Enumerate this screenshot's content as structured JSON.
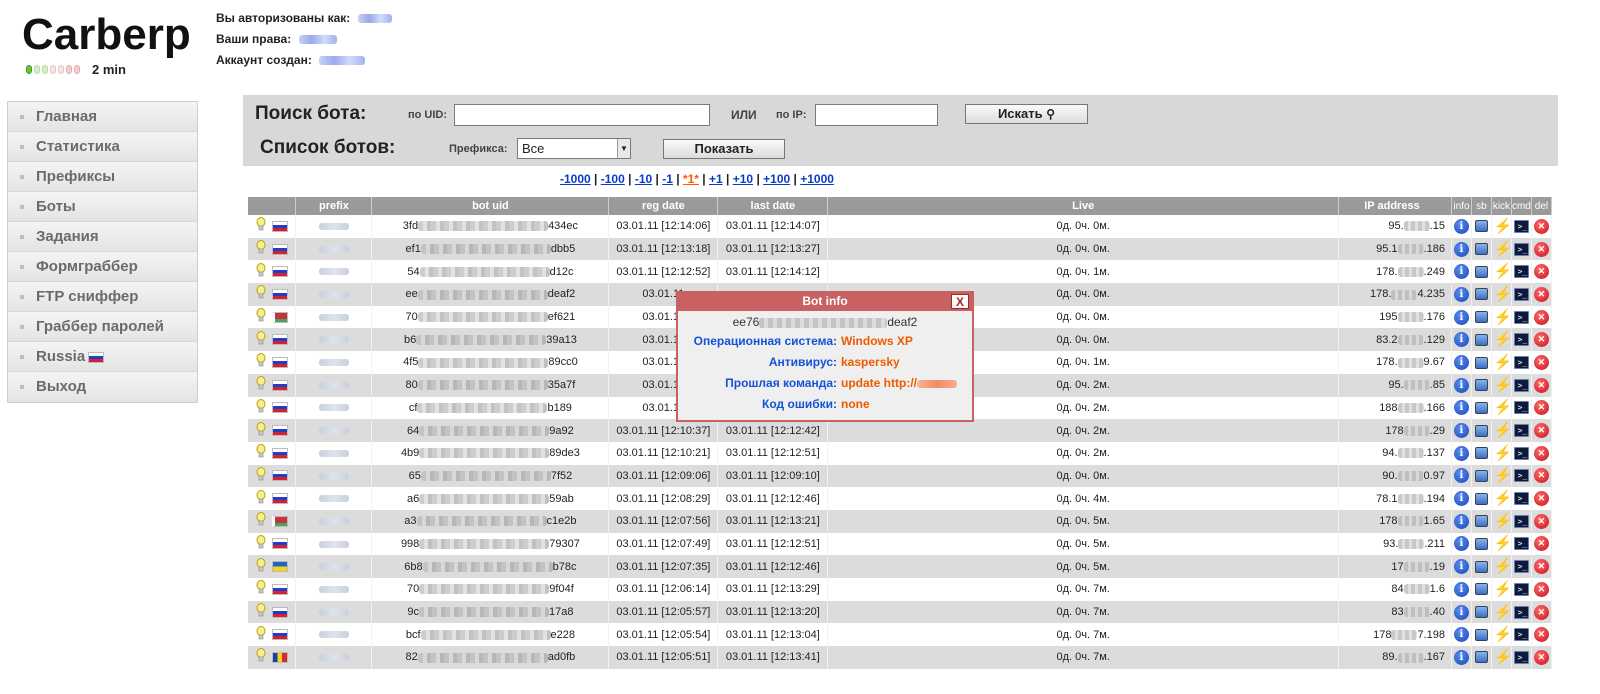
{
  "header": {
    "logo": "Carberp",
    "uptime": "2 min",
    "authorized_as_label": "Вы авторизованы как:",
    "rights_label": "Ваши права:",
    "account_created_label": "Аккаунт создан:"
  },
  "sidebar": {
    "items": [
      {
        "label": "Главная"
      },
      {
        "label": "Статистика"
      },
      {
        "label": "Префиксы"
      },
      {
        "label": "Боты"
      },
      {
        "label": "Задания"
      },
      {
        "label": "Формграббер"
      },
      {
        "label": "FTP сниффер"
      },
      {
        "label": "Граббер паролей"
      },
      {
        "label": "Russia"
      },
      {
        "label": "Выход"
      }
    ]
  },
  "search": {
    "title": "Поиск бота:",
    "uid_label": "по UID:",
    "or_label": "ИЛИ",
    "ip_label": "по IP:",
    "uid_value": "",
    "ip_value": "",
    "search_button": "Искать",
    "list_title": "Список ботов:",
    "prefix_label": "Префикса:",
    "prefix_selected": "Все",
    "show_button": "Показать"
  },
  "pager": {
    "links": [
      "-1000",
      "-100",
      "-10",
      "-1",
      "*1*",
      "+1",
      "+10",
      "+100",
      "+1000"
    ],
    "separator": "|"
  },
  "table": {
    "headers": {
      "prefix": "prefix",
      "uid": "bot uid",
      "reg": "reg date",
      "last": "last date",
      "live": "Live",
      "ip": "IP address",
      "info": "info",
      "sb": "sb",
      "kick": "kick",
      "cmd": "cmd",
      "del": "del"
    },
    "rows": [
      {
        "flag": "ru",
        "uid_start": "3fd",
        "uid_end": "434ec",
        "reg": "03.01.11 [12:14:06]",
        "last": "03.01.11 [12:14:07]",
        "live": "0д. 0ч. 0м.",
        "ip_start": "95.",
        "ip_end": ".15"
      },
      {
        "flag": "ru",
        "uid_start": "ef1",
        "uid_end": "dbb5",
        "reg": "03.01.11 [12:13:18]",
        "last": "03.01.11 [12:13:27]",
        "live": "0д. 0ч. 0м.",
        "ip_start": "95.1",
        "ip_end": ".186"
      },
      {
        "flag": "ru",
        "uid_start": "54",
        "uid_end": "d12c",
        "reg": "03.01.11 [12:12:52]",
        "last": "03.01.11 [12:14:12]",
        "live": "0д. 0ч. 1м.",
        "ip_start": "178.",
        "ip_end": ".249"
      },
      {
        "flag": "ru",
        "uid_start": "ee",
        "uid_end": "deaf2",
        "reg": "03.01.11",
        "last": "",
        "live": "0д. 0ч. 0м.",
        "ip_start": "178.",
        "ip_end": "4.235"
      },
      {
        "flag": "by",
        "uid_start": "70",
        "uid_end": "ef621",
        "reg": "03.01.11",
        "last": "",
        "live": "0д. 0ч. 0м.",
        "ip_start": "195",
        "ip_end": ".176"
      },
      {
        "flag": "ru",
        "uid_start": "b6",
        "uid_end": "39a13",
        "reg": "03.01.11",
        "last": "",
        "live": "0д. 0ч. 0м.",
        "ip_start": "83.2",
        "ip_end": ".129"
      },
      {
        "flag": "ru",
        "uid_start": "4f5",
        "uid_end": "89cc0",
        "reg": "03.01.11",
        "last": "",
        "live": "0д. 0ч. 1м.",
        "ip_start": "178.",
        "ip_end": "9.67"
      },
      {
        "flag": "ru",
        "uid_start": "80",
        "uid_end": "35a7f",
        "reg": "03.01.11",
        "last": "",
        "live": "0д. 0ч. 2м.",
        "ip_start": "95.",
        "ip_end": ".85"
      },
      {
        "flag": "ru",
        "uid_start": "cf",
        "uid_end": "b189",
        "reg": "03.01.11",
        "last": "",
        "live": "0д. 0ч. 2м.",
        "ip_start": "188",
        "ip_end": ".166"
      },
      {
        "flag": "ru",
        "uid_start": "64",
        "uid_end": "9a92",
        "reg": "03.01.11 [12:10:37]",
        "last": "03.01.11 [12:12:42]",
        "live": "0д. 0ч. 2м.",
        "ip_start": "178",
        "ip_end": ".29"
      },
      {
        "flag": "ru",
        "uid_start": "4b9",
        "uid_end": "89de3",
        "reg": "03.01.11 [12:10:21]",
        "last": "03.01.11 [12:12:51]",
        "live": "0д. 0ч. 2м.",
        "ip_start": "94.",
        "ip_end": ".137"
      },
      {
        "flag": "ru",
        "uid_start": "65",
        "uid_end": "7f52",
        "reg": "03.01.11 [12:09:06]",
        "last": "03.01.11 [12:09:10]",
        "live": "0д. 0ч. 0м.",
        "ip_start": "90.",
        "ip_end": "0.97"
      },
      {
        "flag": "ru",
        "uid_start": "a6",
        "uid_end": "59ab",
        "reg": "03.01.11 [12:08:29]",
        "last": "03.01.11 [12:12:46]",
        "live": "0д. 0ч. 4м.",
        "ip_start": "78.1",
        "ip_end": ".194"
      },
      {
        "flag": "by",
        "uid_start": "a3",
        "uid_end": "c1e2b",
        "reg": "03.01.11 [12:07:56]",
        "last": "03.01.11 [12:13:21]",
        "live": "0д. 0ч. 5м.",
        "ip_start": "178",
        "ip_end": "1.65"
      },
      {
        "flag": "ru",
        "uid_start": "998",
        "uid_end": "79307",
        "reg": "03.01.11 [12:07:49]",
        "last": "03.01.11 [12:12:51]",
        "live": "0д. 0ч. 5м.",
        "ip_start": "93.",
        "ip_end": ".211"
      },
      {
        "flag": "ua",
        "uid_start": "6b8",
        "uid_end": "b78c",
        "reg": "03.01.11 [12:07:35]",
        "last": "03.01.11 [12:12:46]",
        "live": "0д. 0ч. 5м.",
        "ip_start": "17",
        "ip_end": ".19"
      },
      {
        "flag": "ru",
        "uid_start": "70",
        "uid_end": "9f04f",
        "reg": "03.01.11 [12:06:14]",
        "last": "03.01.11 [12:13:29]",
        "live": "0д. 0ч. 7м.",
        "ip_start": "84",
        "ip_end": "1.6"
      },
      {
        "flag": "ru",
        "uid_start": "9c",
        "uid_end": "17a8",
        "reg": "03.01.11 [12:05:57]",
        "last": "03.01.11 [12:13:20]",
        "live": "0д. 0ч. 7м.",
        "ip_start": "83",
        "ip_end": ".40"
      },
      {
        "flag": "ru",
        "uid_start": "bcf",
        "uid_end": "e228",
        "reg": "03.01.11 [12:05:54]",
        "last": "03.01.11 [12:13:04]",
        "live": "0д. 0ч. 7м.",
        "ip_start": "178",
        "ip_end": "7.198"
      },
      {
        "flag": "md",
        "uid_start": "82",
        "uid_end": "ad0fb",
        "reg": "03.01.11 [12:05:51]",
        "last": "03.01.11 [12:13:41]",
        "live": "0д. 0ч. 7м.",
        "ip_start": "89.",
        "ip_end": ".167"
      }
    ]
  },
  "popup": {
    "title": "Bot info",
    "close": "X",
    "uid_start": "ee76",
    "uid_end": "deaf2",
    "os_label": "Операционная система:",
    "os_value": "Windows XP",
    "av_label": "Антивирус:",
    "av_value": "kaspersky",
    "last_cmd_label": "Прошлая команда:",
    "last_cmd_value": "update http://",
    "error_label": "Код ошибки:",
    "error_value": "none"
  },
  "colors": {
    "accent_link": "#0a3cc8",
    "current_page": "#ff5a00",
    "popup_border": "#c86262",
    "popup_key": "#1452d6",
    "popup_value": "#f05a00"
  }
}
